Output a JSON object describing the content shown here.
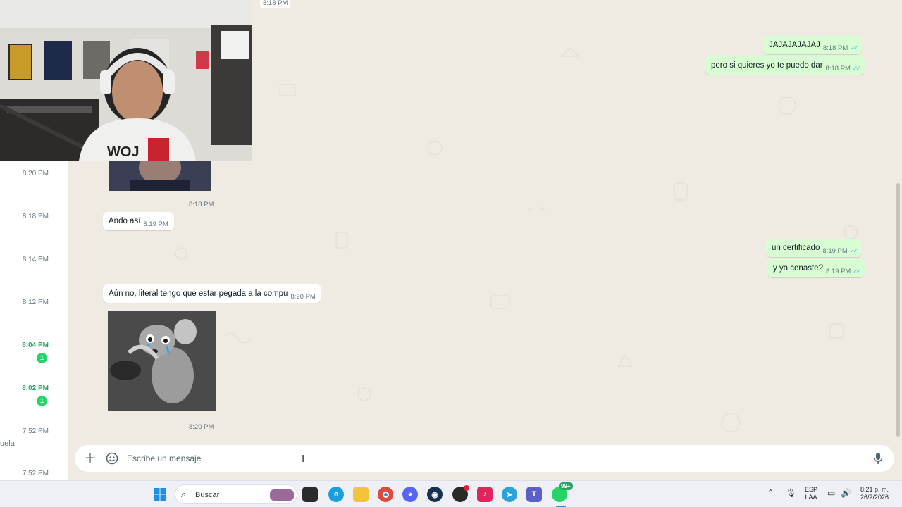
{
  "chat_list": {
    "items": [
      {
        "time": "8:20 PM",
        "highlight": false
      },
      {
        "time": "8:18 PM",
        "highlight": false
      },
      {
        "time": "8:14 PM",
        "highlight": false
      },
      {
        "time": "8:12 PM",
        "highlight": false
      },
      {
        "time": "8:04 PM",
        "highlight": true,
        "badge": "1"
      },
      {
        "time": "8:02 PM",
        "highlight": true,
        "badge": "1"
      },
      {
        "time": "7:52 PM",
        "highlight": false,
        "snippet": "uela"
      },
      {
        "time": "7:52 PM",
        "highlight": false
      }
    ]
  },
  "messages": {
    "top_stamp": "8:18 PM",
    "out1_text": "JAJAJAJAJAJ",
    "out1_time": "8:18 PM",
    "out2_text": "pero si quieres yo te puedo dar",
    "out2_time": "8:18 PM",
    "img1_time": "8:18 PM",
    "in1_text": "Ando así",
    "in1_time": "8:19 PM",
    "out3_text": "un certificado",
    "out3_time": "8:19 PM",
    "out4_text": "y ya cenaste?",
    "out4_time": "8:19 PM",
    "in2_text": "Aún no, literal tengo que estar pegada a la compu",
    "in2_time": "8:20 PM",
    "img2_time": "8:20 PM"
  },
  "composer": {
    "placeholder": "Escribe un mensaje",
    "plus_icon": "plus-icon",
    "sticker_icon": "sticker-icon",
    "mic_icon": "mic-icon"
  },
  "taskbar": {
    "search_label": "Buscar",
    "whatsapp_badge": "99+",
    "lang_line1": "ESP",
    "lang_line2": "LAA",
    "clock_time": "8:21 p. m.",
    "clock_date": "26/2/2026"
  },
  "colors": {
    "chat_bg": "#efeae2",
    "outgoing_bubble": "#d9fdd3",
    "incoming_bubble": "#ffffff",
    "unread_green": "#25d366",
    "read_ticks": "#53bdeb"
  }
}
